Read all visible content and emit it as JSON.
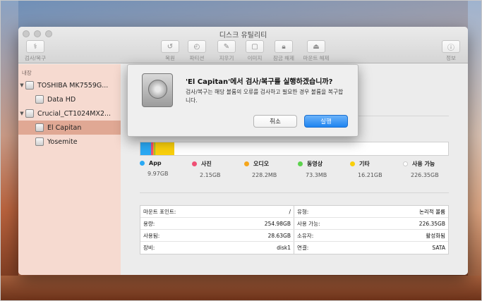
{
  "window": {
    "title": "디스크 유틸리티"
  },
  "toolbar": {
    "first_aid": "검사/복구",
    "restore": "복원",
    "partition": "파티션",
    "erase": "지우기",
    "image": "이미지",
    "lock": "잠금 해제",
    "unmount": "마운트 해제",
    "info": "정보"
  },
  "sidebar": {
    "header": "내장",
    "items": [
      {
        "label": "TOSHIBA MK7559G..."
      },
      {
        "label": "Data HD"
      },
      {
        "label": "Crucial_CT1024MX2..."
      },
      {
        "label": "El Capitan"
      },
      {
        "label": "Yosemite"
      }
    ]
  },
  "usage": [
    {
      "name": "App",
      "size": "9.97GB",
      "color": "#2aa9f4"
    },
    {
      "name": "사진",
      "size": "2.15GB",
      "color": "#ef4f74"
    },
    {
      "name": "오디오",
      "size": "228.2MB",
      "color": "#f5a61b"
    },
    {
      "name": "동영상",
      "size": "73.3MB",
      "color": "#5cd24d"
    },
    {
      "name": "기타",
      "size": "16.21GB",
      "color": "#f9cf0b"
    },
    {
      "name": "사용 가능",
      "size": "226.35GB",
      "color": "#ffffff"
    }
  ],
  "info": {
    "rows": [
      {
        "l_label": "마운트 포인트:",
        "l_value": "/",
        "r_label": "유형:",
        "r_value": "논리적 볼륨"
      },
      {
        "l_label": "용량:",
        "l_value": "254.98GB",
        "r_label": "사용 가능:",
        "r_value": "226.35GB"
      },
      {
        "l_label": "사용됨:",
        "l_value": "28.63GB",
        "r_label": "소유자:",
        "r_value": "활성화됨"
      },
      {
        "l_label": "장비:",
        "l_value": "disk1",
        "r_label": "연결:",
        "r_value": "SATA"
      }
    ]
  },
  "dialog": {
    "title": "'El Capitan'에서 검사/복구를 실행하겠습니까?",
    "message": "검사/복구는 해당 볼륨의 오류를 검사하고 필요한 경우 볼륨을 복구합니다.",
    "cancel": "취소",
    "run": "실행"
  }
}
